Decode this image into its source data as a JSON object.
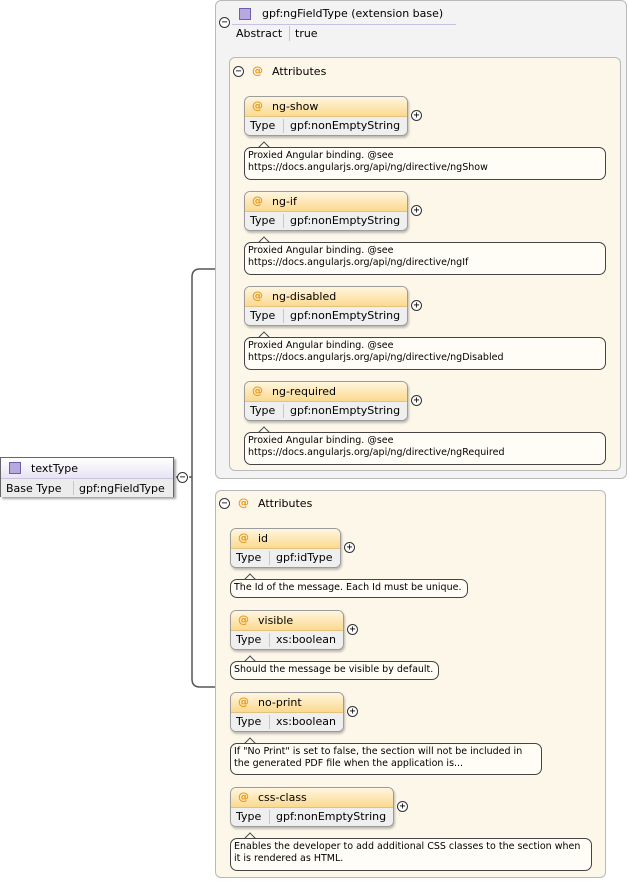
{
  "root": {
    "name": "textType",
    "base_type_label": "Base Type",
    "base_type_value": "gpf:ngFieldType"
  },
  "extension": {
    "title": "gpf:ngFieldType (extension base)",
    "abstract_label": "Abstract",
    "abstract_value": "true",
    "attributes_label": "Attributes",
    "attributes": [
      {
        "name": "ng-show",
        "type_label": "Type",
        "type": "gpf:nonEmptyString",
        "doc": [
          "Proxied Angular binding. @see",
          "https://docs.angularjs.org/api/ng/directive/ngShow"
        ]
      },
      {
        "name": "ng-if",
        "type_label": "Type",
        "type": "gpf:nonEmptyString",
        "doc": [
          "Proxied Angular binding. @see",
          "https://docs.angularjs.org/api/ng/directive/ngIf"
        ]
      },
      {
        "name": "ng-disabled",
        "type_label": "Type",
        "type": "gpf:nonEmptyString",
        "doc": [
          "Proxied Angular binding. @see",
          "https://docs.angularjs.org/api/ng/directive/ngDisabled"
        ]
      },
      {
        "name": "ng-required",
        "type_label": "Type",
        "type": "gpf:nonEmptyString",
        "doc": [
          "Proxied Angular binding. @see",
          "https://docs.angularjs.org/api/ng/directive/ngRequired"
        ]
      }
    ]
  },
  "own_attributes": {
    "attributes_label": "Attributes",
    "attributes": [
      {
        "name": "id",
        "type_label": "Type",
        "type": "gpf:idType",
        "doc": [
          "The Id of the message. Each Id must be unique."
        ]
      },
      {
        "name": "visible",
        "type_label": "Type",
        "type": "xs:boolean",
        "doc": [
          "Should the message be visible by default."
        ]
      },
      {
        "name": "no-print",
        "type_label": "Type",
        "type": "xs:boolean",
        "doc": [
          "If \"No Print\" is set to false, the section will not be included in",
          "the generated PDF file when the application is..."
        ]
      },
      {
        "name": "css-class",
        "type_label": "Type",
        "type": "gpf:nonEmptyString",
        "doc": [
          "Enables the developer to add additional CSS classes to the section when",
          "it is rendered as HTML."
        ]
      }
    ]
  },
  "icons": {
    "expanded": "minus-icon",
    "collapsed": "plus-icon",
    "attribute": "at-icon",
    "complex_type": "complex-type-icon"
  },
  "colors": {
    "attribute_header": "#fbd98f",
    "attribute_at": "#e69a1c",
    "type_icon": "#b8a8e0",
    "attributes_panel_bg": "#fdf7ea"
  }
}
